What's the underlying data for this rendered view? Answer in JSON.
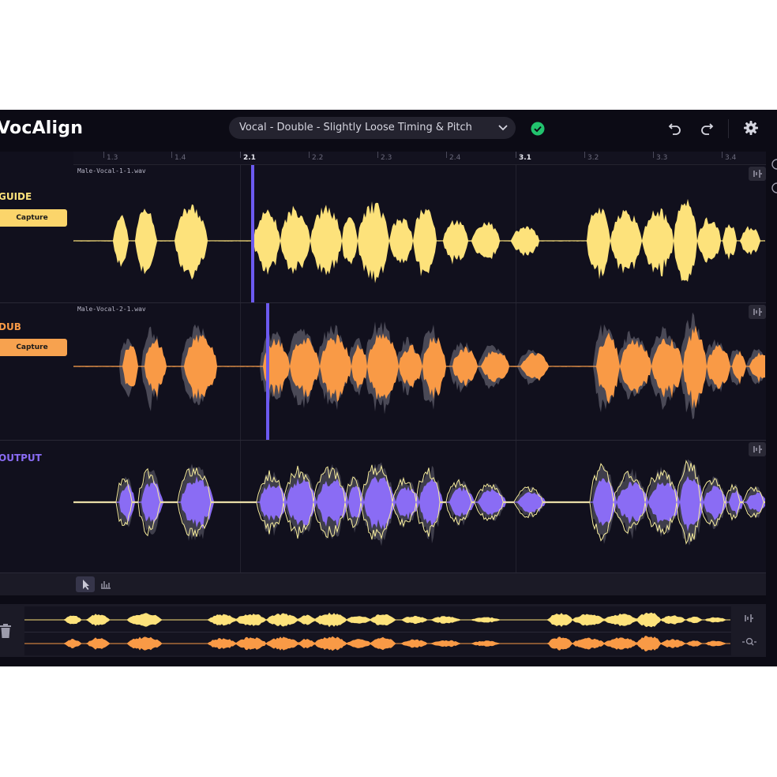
{
  "app": {
    "title": "VocAlign"
  },
  "header": {
    "preset": "Vocal - Double - Slightly Loose Timing & Pitch",
    "status_icon": "check-circle-icon",
    "undo_icon": "undo-icon",
    "redo_icon": "redo-icon",
    "settings_icon": "gear-icon"
  },
  "ruler": {
    "ticks": [
      "1.3",
      "1.4",
      "2.1",
      "2.2",
      "2.3",
      "2.4",
      "3.1",
      "3.2",
      "3.3",
      "3.4"
    ],
    "major": [
      "2.1",
      "3.1"
    ]
  },
  "tracks": {
    "guide": {
      "label": "GUIDE",
      "capture": "Capture",
      "file": "Male-Vocal-1-1.wav",
      "color": "#fde27b"
    },
    "dub": {
      "label": "DUB",
      "capture": "Capture",
      "file": "Male-Vocal-2-1.wav",
      "color": "#f99a46"
    },
    "output": {
      "label": "OUTPUT",
      "color": "#8a6cf4",
      "outline": "#f6ec9c"
    }
  },
  "colors": {
    "background": "#0c0b15",
    "playhead": "#6c5af0",
    "shadow": "#4a4956"
  }
}
